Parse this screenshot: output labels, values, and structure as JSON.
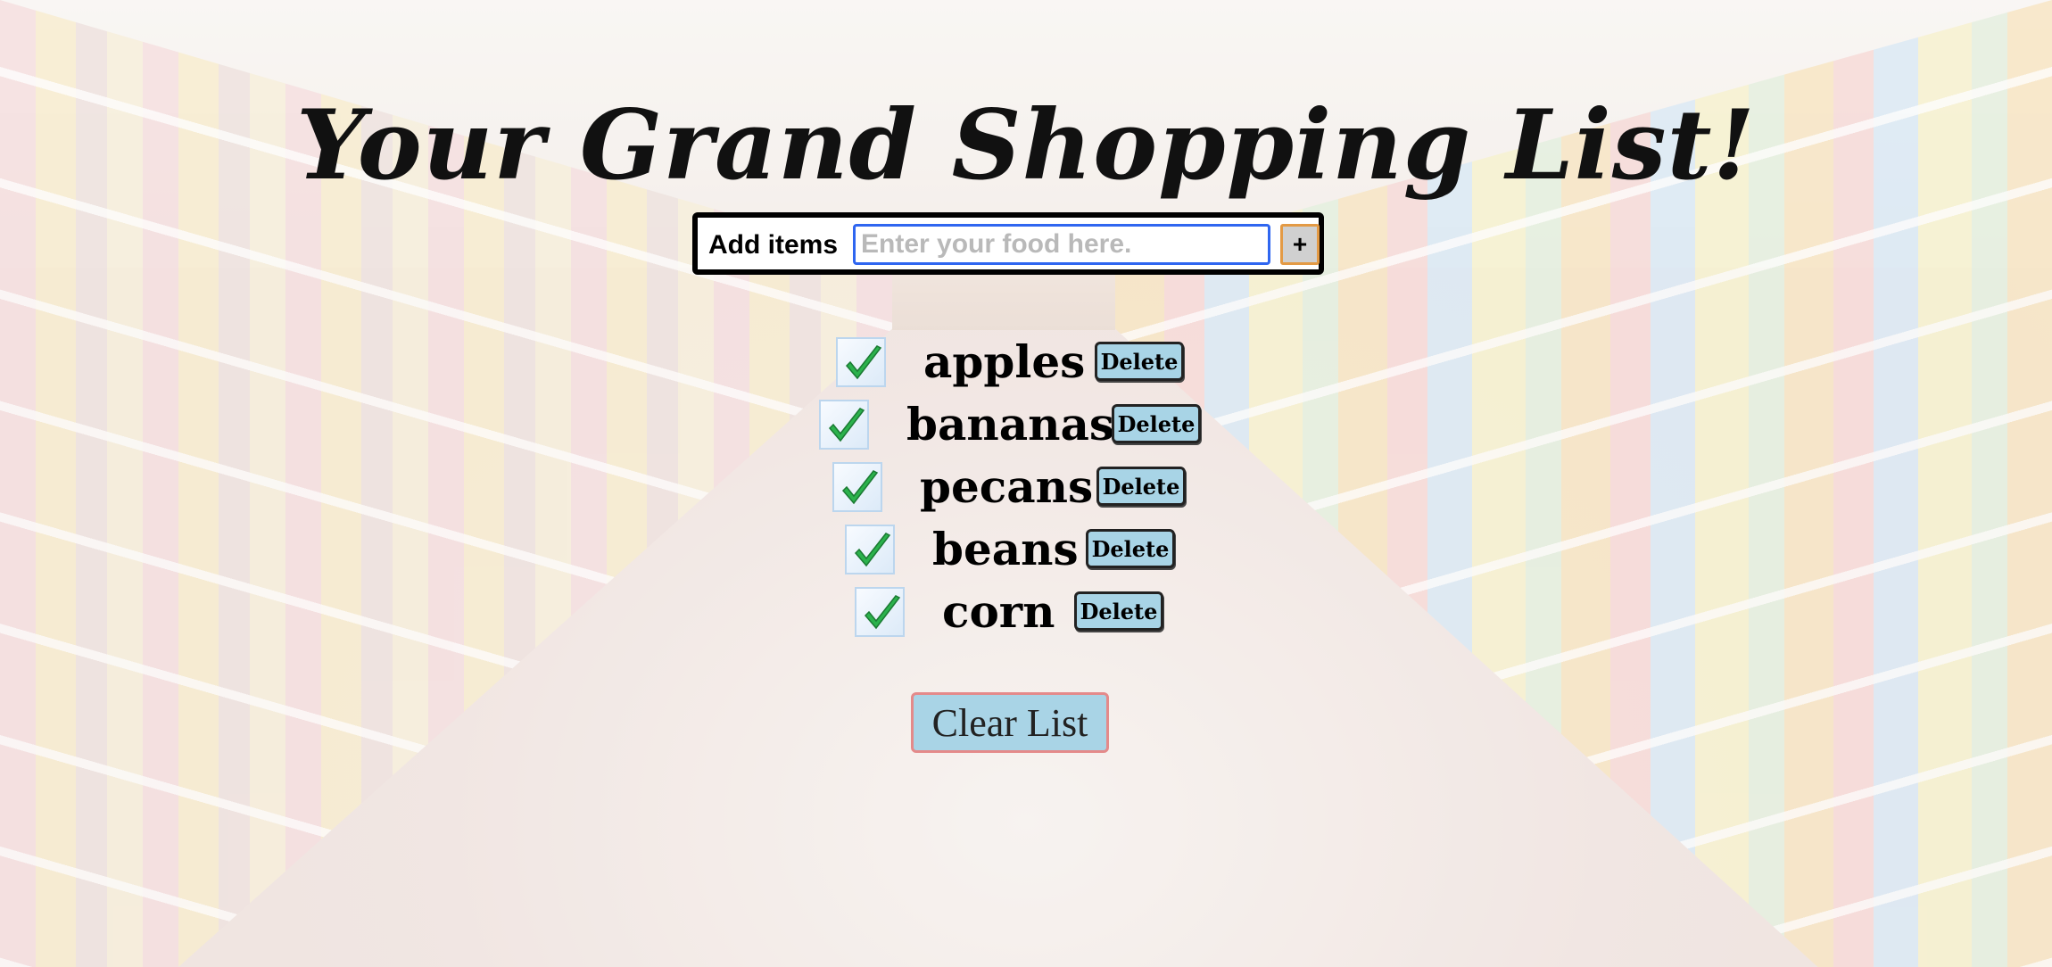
{
  "title": "Your Grand Shopping List!",
  "add_form": {
    "label": "Add items",
    "placeholder": "Enter your food here.",
    "value": "",
    "add_button": "+"
  },
  "items": [
    {
      "name": "apples",
      "checked": true,
      "delete_label": "Delete"
    },
    {
      "name": "bananas",
      "checked": true,
      "delete_label": "Delete"
    },
    {
      "name": "pecans",
      "checked": true,
      "delete_label": "Delete"
    },
    {
      "name": "beans",
      "checked": true,
      "delete_label": "Delete"
    },
    {
      "name": "corn",
      "checked": true,
      "delete_label": "Delete"
    }
  ],
  "clear_button": "Clear List",
  "colors": {
    "button_fill": "#a8d4e6",
    "input_border": "#2f66f0",
    "clear_border": "#e48a8a",
    "check_green": "#2bb24c"
  },
  "icons": {
    "item_check": "checkmark-icon"
  }
}
